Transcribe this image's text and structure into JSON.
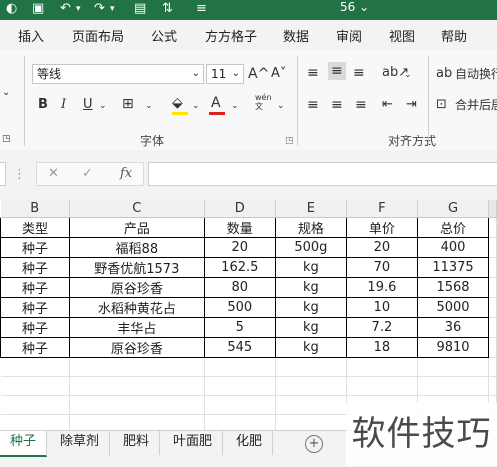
{
  "titlebar": {
    "title": "56 ⌄"
  },
  "menu": {
    "tabs": [
      "插入",
      "页面布局",
      "公式",
      "方方格子",
      "数据",
      "审阅",
      "视图",
      "帮助"
    ]
  },
  "ribbon": {
    "font_name": "等线",
    "font_size": "11",
    "grow_font": "A^",
    "shrink_font": "A˅",
    "bold": "B",
    "italic": "I",
    "underline": "U",
    "font_group_label": "字体",
    "align_group_label": "对齐方式",
    "wrap_text": "自动换行",
    "merge_center": "合并后居中",
    "phonetic": "wén\n文",
    "fill_color": "#FFE600",
    "font_color": "#E02020"
  },
  "formula_bar": {
    "fx_label": "fx",
    "value": ""
  },
  "sheet": {
    "columns": [
      "B",
      "C",
      "D",
      "E",
      "F",
      "G"
    ],
    "header": [
      "类型",
      "产品",
      "数量",
      "规格",
      "单价",
      "总价"
    ],
    "rows": [
      [
        "种子",
        "福稻88",
        "20",
        "500g",
        "20",
        "400"
      ],
      [
        "种子",
        "野香优航1573",
        "162.5",
        "kg",
        "70",
        "11375"
      ],
      [
        "种子",
        "原谷珍香",
        "80",
        "kg",
        "19.6",
        "1568"
      ],
      [
        "种子",
        "水稻种黄花占",
        "500",
        "kg",
        "10",
        "5000"
      ],
      [
        "种子",
        "丰华占",
        "5",
        "kg",
        "7.2",
        "36"
      ],
      [
        "种子",
        "原谷珍香",
        "545",
        "kg",
        "18",
        "9810"
      ]
    ]
  },
  "sheet_tabs": [
    "种子",
    "除草剂",
    "肥料",
    "叶面肥",
    "化肥"
  ],
  "watermark": "软件技巧"
}
